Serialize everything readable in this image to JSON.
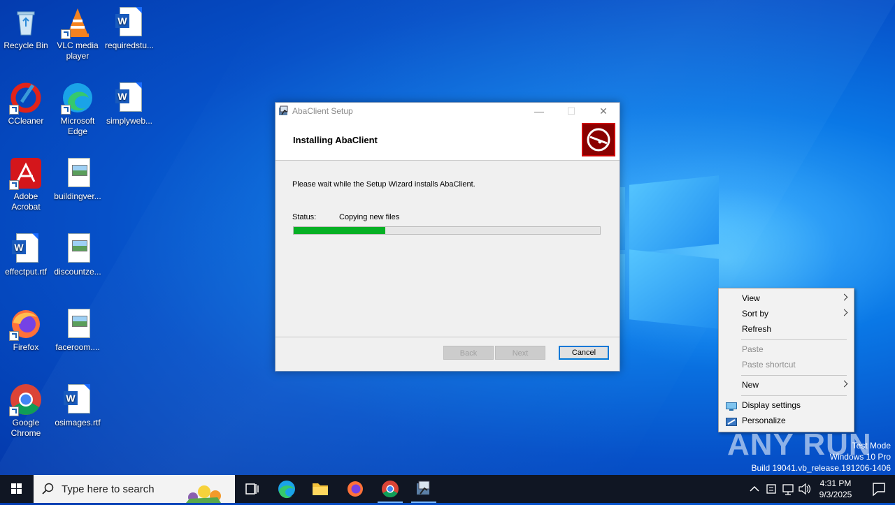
{
  "desktop": {
    "icons": [
      {
        "label": "Recycle Bin",
        "icon": "recycle-bin-icon"
      },
      {
        "label": "VLC media player",
        "icon": "vlc-icon"
      },
      {
        "label": "requiredstu...",
        "icon": "word-doc-icon"
      },
      {
        "label": "CCleaner",
        "icon": "ccleaner-icon"
      },
      {
        "label": "Microsoft Edge",
        "icon": "edge-icon"
      },
      {
        "label": "simplyweb...",
        "icon": "word-doc-icon"
      },
      {
        "label": "Adobe Acrobat",
        "icon": "acrobat-icon"
      },
      {
        "label": "buildingver...",
        "icon": "image-file-icon"
      },
      {
        "label": "effectput.rtf",
        "icon": "word-doc-icon"
      },
      {
        "label": "discountze...",
        "icon": "image-file-icon"
      },
      {
        "label": "Firefox",
        "icon": "firefox-icon"
      },
      {
        "label": "faceroom....",
        "icon": "image-file-icon"
      },
      {
        "label": "Google Chrome",
        "icon": "chrome-icon"
      },
      {
        "label": "osimages.rtf",
        "icon": "word-doc-icon"
      }
    ]
  },
  "dialog": {
    "title": "AbaClient Setup",
    "header_title": "Installing AbaClient",
    "wait_text": "Please wait while the Setup Wizard installs AbaClient.",
    "status_label": "Status:",
    "status_value": "Copying new files",
    "progress_fraction": 0.3,
    "buttons": {
      "back": "Back",
      "next": "Next",
      "cancel": "Cancel"
    }
  },
  "context_menu": {
    "view": "View",
    "sort_by": "Sort by",
    "refresh": "Refresh",
    "paste": "Paste",
    "paste_shortcut": "Paste shortcut",
    "new": "New",
    "display_settings": "Display settings",
    "personalize": "Personalize"
  },
  "watermark": {
    "brand": "ANY RUN",
    "line1": "Test Mode",
    "line2": "Windows 10 Pro",
    "line3": "Build 19041.vb_release.191206-1406"
  },
  "taskbar": {
    "search_placeholder": "Type here to search",
    "time": "4:31 PM",
    "date": "9/3/2025"
  },
  "colors": {
    "progress_fill": "#06b025",
    "accent": "#0078d7",
    "taskbar": "#101623"
  }
}
